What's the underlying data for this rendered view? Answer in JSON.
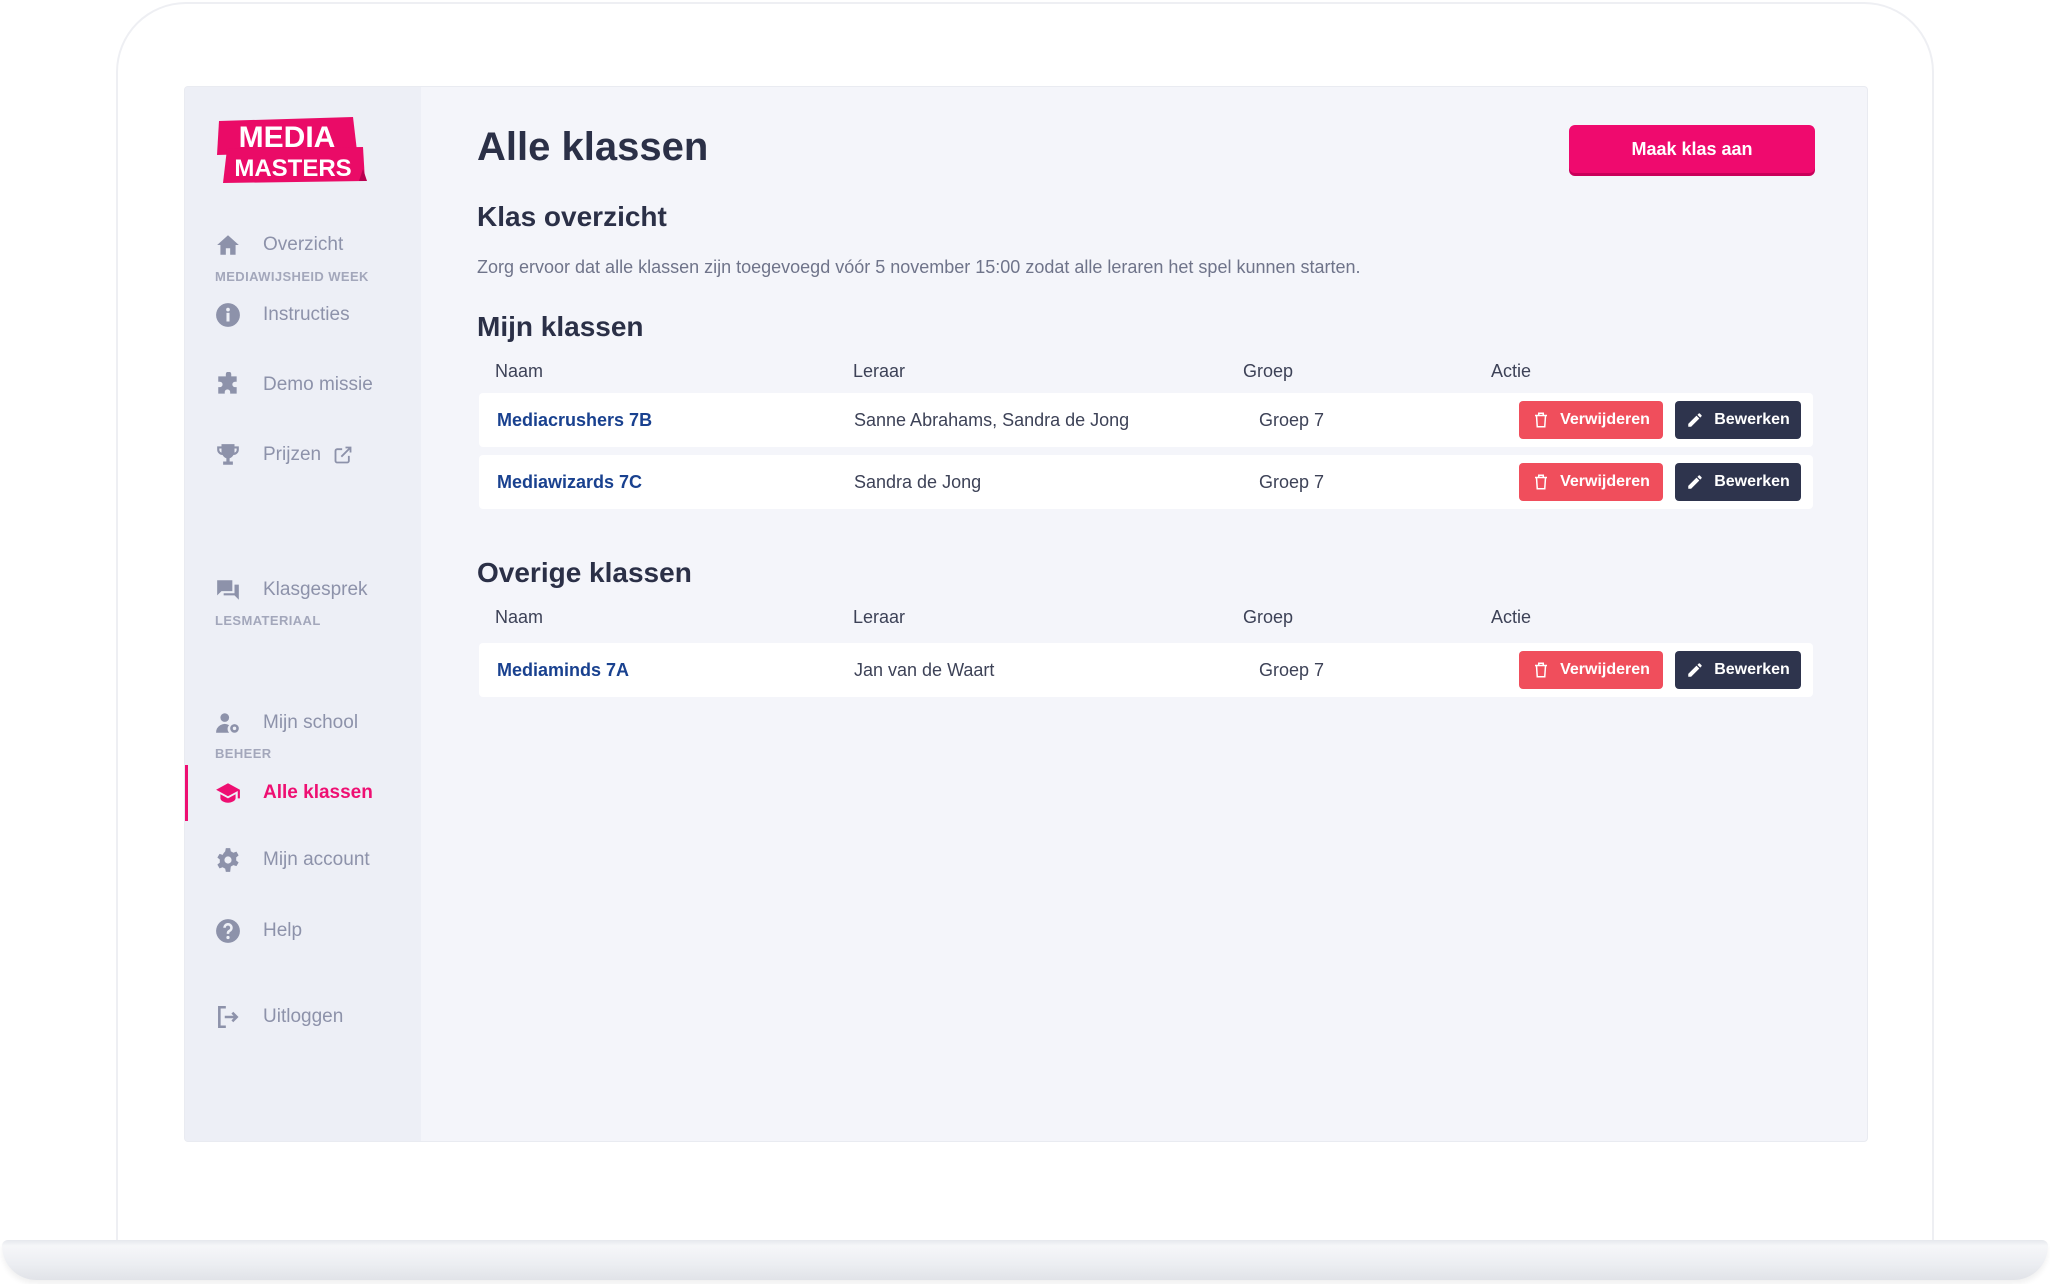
{
  "logo": {
    "line1": "MEDIA",
    "line2": "MASTERS"
  },
  "sidebar": {
    "sections": [
      {
        "title": "MEDIAWIJSHEID WEEK"
      },
      {
        "title": "LESMATERIAAL"
      },
      {
        "title": "BEHEER"
      }
    ],
    "items": [
      {
        "label": "Overzicht",
        "icon": "home-icon"
      },
      {
        "label": "Instructies",
        "icon": "info-icon"
      },
      {
        "label": "Demo missie",
        "icon": "puzzle-icon"
      },
      {
        "label": "Prijzen",
        "icon": "trophy-icon",
        "external": true
      },
      {
        "label": "Klasgesprek",
        "icon": "chat-icon"
      },
      {
        "label": "Mijn school",
        "icon": "user-cog-icon"
      },
      {
        "label": "Alle klassen",
        "icon": "graduation-cap-icon",
        "active": true
      },
      {
        "label": "Mijn account",
        "icon": "gear-icon"
      },
      {
        "label": "Help",
        "icon": "question-icon"
      },
      {
        "label": "Uitloggen",
        "icon": "logout-icon"
      }
    ]
  },
  "header": {
    "title": "Alle klassen",
    "create_button": "Maak klas aan"
  },
  "overview": {
    "title": "Klas overzicht",
    "description": "Zorg ervoor dat alle klassen zijn toegevoegd vóór 5 november 15:00 zodat alle leraren het spel kunnen starten."
  },
  "columns": {
    "name": "Naam",
    "teacher": "Leraar",
    "group": "Groep",
    "action": "Actie"
  },
  "actions": {
    "delete": "Verwijderen",
    "edit": "Bewerken"
  },
  "my_classes": {
    "title": "Mijn klassen",
    "rows": [
      {
        "name": "Mediacrushers 7B",
        "teacher": "Sanne Abrahams, Sandra de Jong",
        "group": "Groep 7"
      },
      {
        "name": "Mediawizards 7C",
        "teacher": "Sandra de Jong",
        "group": "Groep 7"
      }
    ]
  },
  "other_classes": {
    "title": "Overige klassen",
    "rows": [
      {
        "name": "Mediaminds 7A",
        "teacher": "Jan van de Waart",
        "group": "Groep 7"
      }
    ]
  },
  "colors": {
    "accent": "#ee0f72",
    "delete": "#f04e5c",
    "edit": "#2e344d",
    "link": "#19418f"
  }
}
